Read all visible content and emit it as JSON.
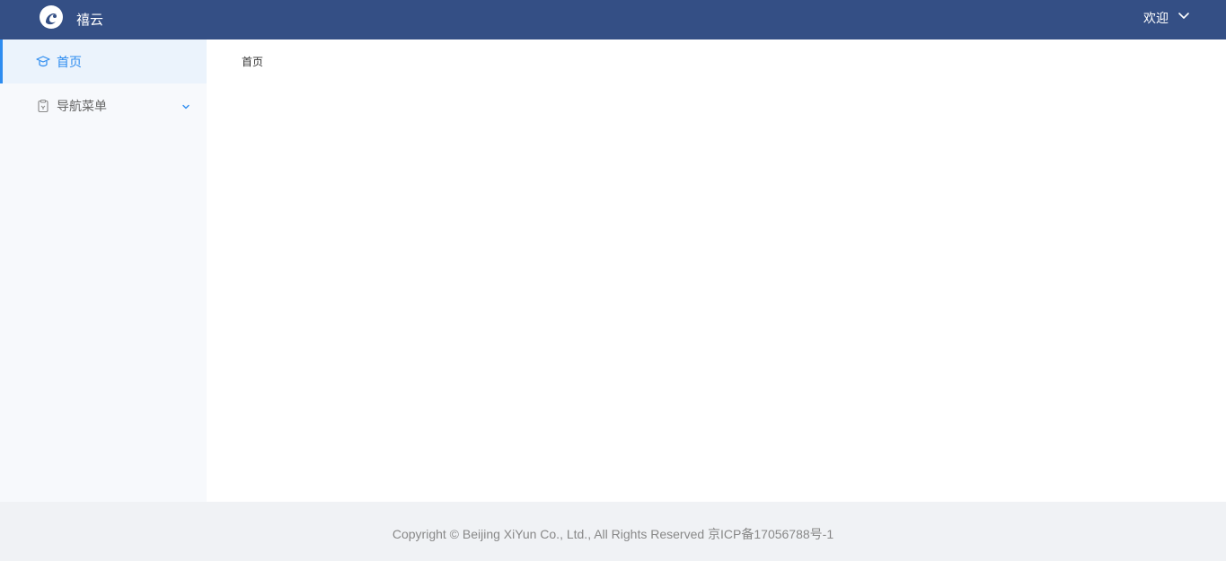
{
  "header": {
    "brand": "禧云",
    "user_menu_label": "欢迎",
    "logo_icon": "brand-logo-icon",
    "chevron_icon": "chevron-down-icon"
  },
  "sidebar": {
    "items": [
      {
        "label": "首页",
        "icon": "graduation-cap-icon",
        "active": true
      },
      {
        "label": "导航菜单",
        "icon": "clipboard-icon",
        "active": false,
        "expandable": true
      }
    ]
  },
  "breadcrumb": {
    "current": "首页"
  },
  "footer": {
    "copyright": "Copyright © Beijing XiYun Co., Ltd., All Rights Reserved 京ICP备17056788号-1"
  },
  "colors": {
    "header_bg": "#344f85",
    "accent": "#2d8cf0",
    "sidebar_bg": "#f7f9fc",
    "active_item_bg": "#ebf3fc",
    "footer_bg": "#f0f2f5"
  }
}
